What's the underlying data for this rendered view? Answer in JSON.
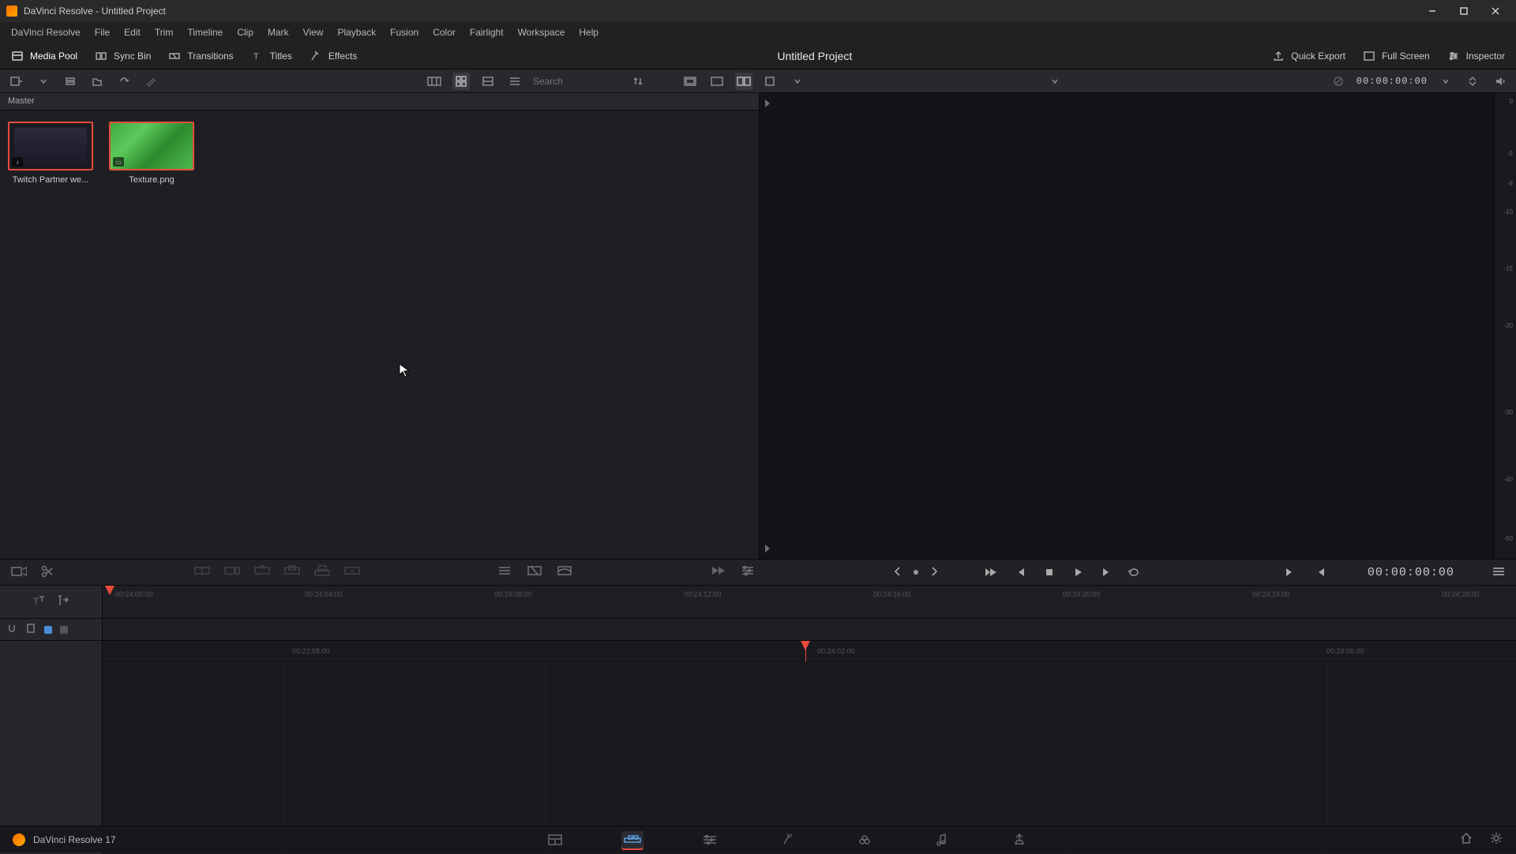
{
  "window": {
    "title": "DaVinci Resolve - Untitled Project"
  },
  "menu": {
    "items": [
      "DaVinci Resolve",
      "File",
      "Edit",
      "Trim",
      "Timeline",
      "Clip",
      "Mark",
      "View",
      "Playback",
      "Fusion",
      "Color",
      "Fairlight",
      "Workspace",
      "Help"
    ]
  },
  "toolbar": {
    "media_pool": "Media Pool",
    "sync_bin": "Sync Bin",
    "transitions": "Transitions",
    "titles": "Titles",
    "effects": "Effects",
    "project_title": "Untitled Project",
    "quick_export": "Quick Export",
    "full_screen": "Full Screen",
    "inspector": "Inspector"
  },
  "utilbar": {
    "search_placeholder": "Search",
    "viewer_timecode": "00:00:00:00"
  },
  "pool": {
    "bin_label": "Master",
    "clips": [
      {
        "name": "Twitch Partner we...",
        "type": "video",
        "audio_badge": "♪"
      },
      {
        "name": "Texture.png",
        "type": "image"
      }
    ]
  },
  "meter": {
    "ticks": [
      "0",
      "-5",
      "-8",
      "-10",
      "-15",
      "-20",
      "-30",
      "-40",
      "-50"
    ]
  },
  "transport": {
    "timecode": "00:00:00:00"
  },
  "timeline": {
    "ruler1": [
      "00:24:00:00",
      "00:24:04:00",
      "00:24:08:00",
      "00:24:12:00",
      "00:24:16:00",
      "00:24:20:00",
      "00:24:24:00",
      "00:24:28:00"
    ],
    "ruler2_left": "00:23:58:00",
    "ruler2_right": "00:24:06:00"
  },
  "bottombar": {
    "app_name": "DaVinci Resolve 17"
  }
}
